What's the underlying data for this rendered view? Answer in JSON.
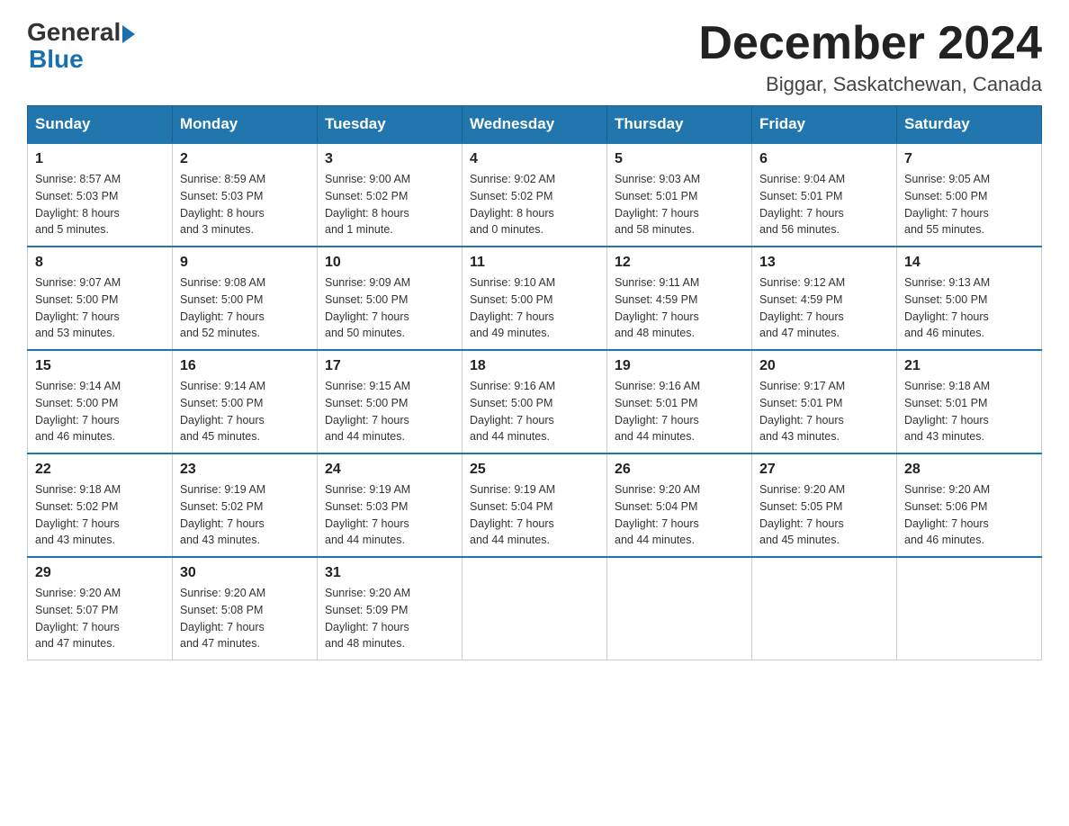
{
  "header": {
    "logo": {
      "general": "General",
      "blue": "Blue"
    },
    "title": "December 2024",
    "location": "Biggar, Saskatchewan, Canada"
  },
  "days_of_week": [
    "Sunday",
    "Monday",
    "Tuesday",
    "Wednesday",
    "Thursday",
    "Friday",
    "Saturday"
  ],
  "weeks": [
    [
      {
        "day": "1",
        "sunrise": "8:57 AM",
        "sunset": "5:03 PM",
        "daylight": "8 hours and 5 minutes."
      },
      {
        "day": "2",
        "sunrise": "8:59 AM",
        "sunset": "5:03 PM",
        "daylight": "8 hours and 3 minutes."
      },
      {
        "day": "3",
        "sunrise": "9:00 AM",
        "sunset": "5:02 PM",
        "daylight": "8 hours and 1 minute."
      },
      {
        "day": "4",
        "sunrise": "9:02 AM",
        "sunset": "5:02 PM",
        "daylight": "8 hours and 0 minutes."
      },
      {
        "day": "5",
        "sunrise": "9:03 AM",
        "sunset": "5:01 PM",
        "daylight": "7 hours and 58 minutes."
      },
      {
        "day": "6",
        "sunrise": "9:04 AM",
        "sunset": "5:01 PM",
        "daylight": "7 hours and 56 minutes."
      },
      {
        "day": "7",
        "sunrise": "9:05 AM",
        "sunset": "5:00 PM",
        "daylight": "7 hours and 55 minutes."
      }
    ],
    [
      {
        "day": "8",
        "sunrise": "9:07 AM",
        "sunset": "5:00 PM",
        "daylight": "7 hours and 53 minutes."
      },
      {
        "day": "9",
        "sunrise": "9:08 AM",
        "sunset": "5:00 PM",
        "daylight": "7 hours and 52 minutes."
      },
      {
        "day": "10",
        "sunrise": "9:09 AM",
        "sunset": "5:00 PM",
        "daylight": "7 hours and 50 minutes."
      },
      {
        "day": "11",
        "sunrise": "9:10 AM",
        "sunset": "5:00 PM",
        "daylight": "7 hours and 49 minutes."
      },
      {
        "day": "12",
        "sunrise": "9:11 AM",
        "sunset": "4:59 PM",
        "daylight": "7 hours and 48 minutes."
      },
      {
        "day": "13",
        "sunrise": "9:12 AM",
        "sunset": "4:59 PM",
        "daylight": "7 hours and 47 minutes."
      },
      {
        "day": "14",
        "sunrise": "9:13 AM",
        "sunset": "5:00 PM",
        "daylight": "7 hours and 46 minutes."
      }
    ],
    [
      {
        "day": "15",
        "sunrise": "9:14 AM",
        "sunset": "5:00 PM",
        "daylight": "7 hours and 46 minutes."
      },
      {
        "day": "16",
        "sunrise": "9:14 AM",
        "sunset": "5:00 PM",
        "daylight": "7 hours and 45 minutes."
      },
      {
        "day": "17",
        "sunrise": "9:15 AM",
        "sunset": "5:00 PM",
        "daylight": "7 hours and 44 minutes."
      },
      {
        "day": "18",
        "sunrise": "9:16 AM",
        "sunset": "5:00 PM",
        "daylight": "7 hours and 44 minutes."
      },
      {
        "day": "19",
        "sunrise": "9:16 AM",
        "sunset": "5:01 PM",
        "daylight": "7 hours and 44 minutes."
      },
      {
        "day": "20",
        "sunrise": "9:17 AM",
        "sunset": "5:01 PM",
        "daylight": "7 hours and 43 minutes."
      },
      {
        "day": "21",
        "sunrise": "9:18 AM",
        "sunset": "5:01 PM",
        "daylight": "7 hours and 43 minutes."
      }
    ],
    [
      {
        "day": "22",
        "sunrise": "9:18 AM",
        "sunset": "5:02 PM",
        "daylight": "7 hours and 43 minutes."
      },
      {
        "day": "23",
        "sunrise": "9:19 AM",
        "sunset": "5:02 PM",
        "daylight": "7 hours and 43 minutes."
      },
      {
        "day": "24",
        "sunrise": "9:19 AM",
        "sunset": "5:03 PM",
        "daylight": "7 hours and 44 minutes."
      },
      {
        "day": "25",
        "sunrise": "9:19 AM",
        "sunset": "5:04 PM",
        "daylight": "7 hours and 44 minutes."
      },
      {
        "day": "26",
        "sunrise": "9:20 AM",
        "sunset": "5:04 PM",
        "daylight": "7 hours and 44 minutes."
      },
      {
        "day": "27",
        "sunrise": "9:20 AM",
        "sunset": "5:05 PM",
        "daylight": "7 hours and 45 minutes."
      },
      {
        "day": "28",
        "sunrise": "9:20 AM",
        "sunset": "5:06 PM",
        "daylight": "7 hours and 46 minutes."
      }
    ],
    [
      {
        "day": "29",
        "sunrise": "9:20 AM",
        "sunset": "5:07 PM",
        "daylight": "7 hours and 47 minutes."
      },
      {
        "day": "30",
        "sunrise": "9:20 AM",
        "sunset": "5:08 PM",
        "daylight": "7 hours and 47 minutes."
      },
      {
        "day": "31",
        "sunrise": "9:20 AM",
        "sunset": "5:09 PM",
        "daylight": "7 hours and 48 minutes."
      },
      null,
      null,
      null,
      null
    ]
  ],
  "labels": {
    "sunrise": "Sunrise:",
    "sunset": "Sunset:",
    "daylight": "Daylight:"
  }
}
